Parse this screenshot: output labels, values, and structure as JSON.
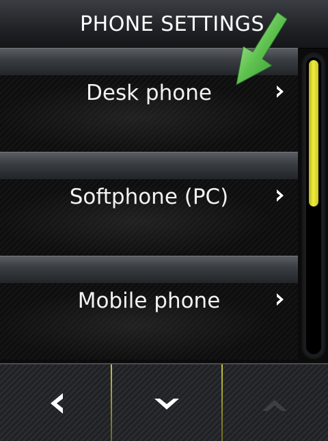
{
  "header": {
    "title": "PHONE SETTINGS"
  },
  "settings_list": {
    "items": [
      {
        "label": "Desk phone",
        "chevron_icon": "chevron-right-icon"
      },
      {
        "label": "Softphone (PC)",
        "chevron_icon": "chevron-right-icon"
      },
      {
        "label": "Mobile phone",
        "chevron_icon": "chevron-right-icon"
      }
    ]
  },
  "scrollbar": {
    "thumb_color": "#f0ec3a",
    "position_fraction": 0.0
  },
  "annotation": {
    "icon": "green-pointer-arrow-icon",
    "color": "#3fae3f"
  },
  "footer": {
    "buttons": [
      {
        "icon": "chevron-left-icon",
        "enabled": true
      },
      {
        "icon": "chevron-down-icon",
        "enabled": true
      },
      {
        "icon": "chevron-up-icon",
        "enabled": false
      }
    ],
    "divider_color": "#c8c53a"
  }
}
